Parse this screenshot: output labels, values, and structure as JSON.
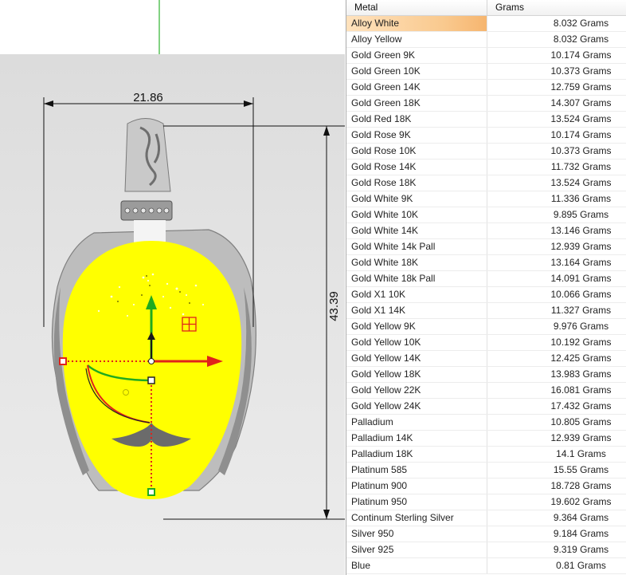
{
  "viewport": {
    "width_dimension": "21.86",
    "height_dimension": "43.39",
    "colors": {
      "model_highlight": "#ffff00",
      "x_axis": "#e0221b",
      "y_axis": "#1faa1f",
      "z_axis": "#1a1a1a",
      "grid_line": "#2fb52f"
    }
  },
  "table": {
    "columns": [
      "Metal",
      "Grams"
    ],
    "selected_row": "Alloy White",
    "rows": [
      {
        "metal": "Alloy White",
        "grams": "8.032 Grams"
      },
      {
        "metal": "Alloy Yellow",
        "grams": "8.032 Grams"
      },
      {
        "metal": "Gold Green 9K",
        "grams": "10.174 Grams"
      },
      {
        "metal": "Gold Green 10K",
        "grams": "10.373 Grams"
      },
      {
        "metal": "Gold Green 14K",
        "grams": "12.759 Grams"
      },
      {
        "metal": "Gold Green 18K",
        "grams": "14.307 Grams"
      },
      {
        "metal": "Gold Red 18K",
        "grams": "13.524 Grams"
      },
      {
        "metal": "Gold Rose 9K",
        "grams": "10.174 Grams"
      },
      {
        "metal": "Gold Rose 10K",
        "grams": "10.373 Grams"
      },
      {
        "metal": "Gold Rose 14K",
        "grams": "11.732 Grams"
      },
      {
        "metal": "Gold Rose 18K",
        "grams": "13.524 Grams"
      },
      {
        "metal": "Gold White 9K",
        "grams": "11.336 Grams"
      },
      {
        "metal": "Gold White 10K",
        "grams": "9.895 Grams"
      },
      {
        "metal": "Gold White 14K",
        "grams": "13.146 Grams"
      },
      {
        "metal": "Gold White 14k Pall",
        "grams": "12.939 Grams"
      },
      {
        "metal": "Gold White 18K",
        "grams": "13.164 Grams"
      },
      {
        "metal": "Gold White 18k Pall",
        "grams": "14.091 Grams"
      },
      {
        "metal": "Gold X1 10K",
        "grams": "10.066 Grams"
      },
      {
        "metal": "Gold X1 14K",
        "grams": "11.327 Grams"
      },
      {
        "metal": "Gold Yellow 9K",
        "grams": "9.976 Grams"
      },
      {
        "metal": "Gold Yellow 10K",
        "grams": "10.192 Grams"
      },
      {
        "metal": "Gold Yellow 14K",
        "grams": "12.425 Grams"
      },
      {
        "metal": "Gold Yellow 18K",
        "grams": "13.983 Grams"
      },
      {
        "metal": "Gold Yellow 22K",
        "grams": "16.081 Grams"
      },
      {
        "metal": "Gold Yellow 24K",
        "grams": "17.432 Grams"
      },
      {
        "metal": "Palladium",
        "grams": "10.805 Grams"
      },
      {
        "metal": "Palladium 14K",
        "grams": "12.939 Grams"
      },
      {
        "metal": "Palladium 18K",
        "grams": "14.1 Grams"
      },
      {
        "metal": "Platinum 585",
        "grams": "15.55 Grams"
      },
      {
        "metal": "Platinum 900",
        "grams": "18.728 Grams"
      },
      {
        "metal": "Platinum 950",
        "grams": "19.602 Grams"
      },
      {
        "metal": "Continum Sterling Silver",
        "grams": "9.364 Grams"
      },
      {
        "metal": "Silver 950",
        "grams": "9.184 Grams"
      },
      {
        "metal": "Silver 925",
        "grams": "9.319 Grams"
      },
      {
        "metal": "Blue",
        "grams": "0.81 Grams"
      }
    ]
  }
}
